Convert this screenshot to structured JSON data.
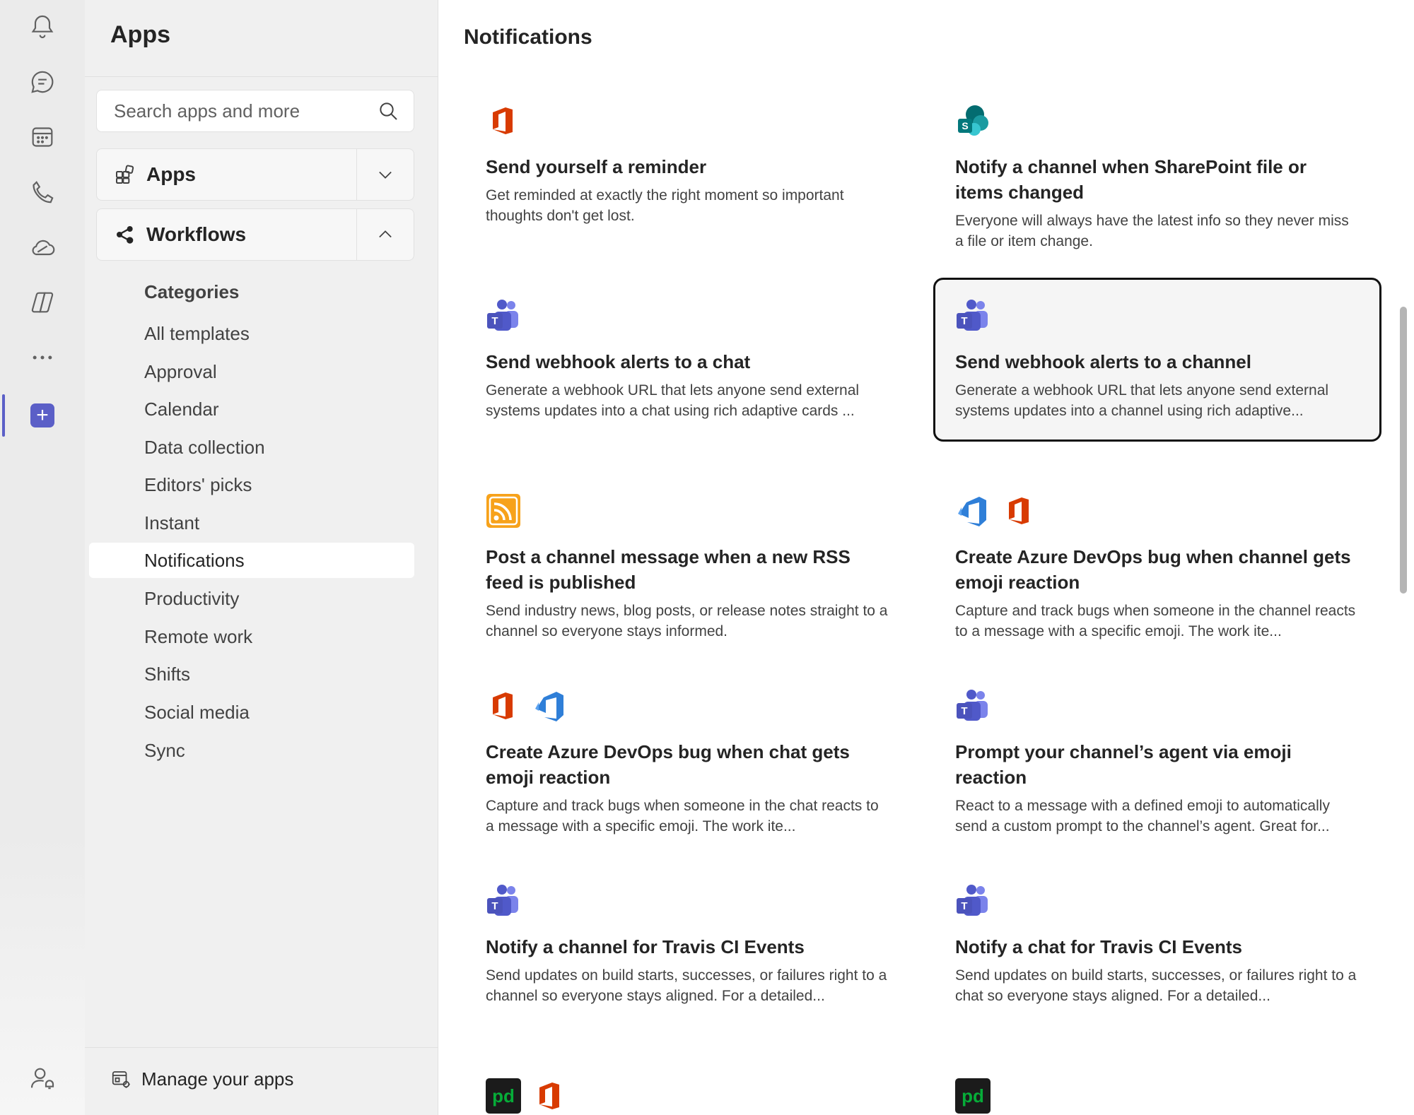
{
  "sidebar": {
    "title": "Apps",
    "search": {
      "placeholder": "Search apps and more",
      "value": ""
    },
    "sections": [
      {
        "label": "Apps",
        "expanded": false
      },
      {
        "label": "Workflows",
        "expanded": true
      }
    ],
    "categories_heading": "Categories",
    "categories": [
      "All templates",
      "Approval",
      "Calendar",
      "Data collection",
      "Editors' picks",
      "Instant",
      "Notifications",
      "Productivity",
      "Remote work",
      "Shifts",
      "Social media",
      "Sync"
    ],
    "selected_category": "Notifications",
    "manage_label": "Manage your apps"
  },
  "main": {
    "title": "Notifications",
    "cards": [
      {
        "title": "Send yourself a reminder",
        "desc": "Get reminded at exactly the right moment so important thoughts don't get lost.",
        "icons": [
          "office-icon"
        ]
      },
      {
        "title": "Notify a channel when SharePoint file or items changed",
        "desc": "Everyone will always have the latest info so they never miss a file or item change.",
        "icons": [
          "sharepoint-icon"
        ]
      },
      {
        "title": "Send webhook alerts to a chat",
        "desc": "Generate a webhook URL that lets anyone send external systems updates into a chat using rich adaptive cards ...",
        "icons": [
          "teams-icon"
        ]
      },
      {
        "title": "Send webhook alerts to a channel",
        "desc": "Generate a webhook URL that lets anyone send external systems updates into a channel using rich adaptive...",
        "icons": [
          "teams-icon"
        ]
      },
      {
        "title": "Post a channel message when a new RSS feed is published",
        "desc": "Send industry news, blog posts, or release notes straight to a channel so everyone stays informed.",
        "icons": [
          "rss-icon"
        ]
      },
      {
        "title": "Create Azure DevOps bug when channel gets emoji reaction",
        "desc": "Capture and track bugs when someone in the channel reacts to a message with a specific emoji. The work ite...",
        "icons": [
          "azure-devops-icon",
          "office-icon"
        ]
      },
      {
        "title": "Create Azure DevOps bug when chat gets emoji reaction",
        "desc": "Capture and track bugs when someone in the chat reacts to a message with a specific emoji. The work ite...",
        "icons": [
          "office-icon",
          "azure-devops-icon"
        ]
      },
      {
        "title": "Prompt your channel’s agent via emoji reaction",
        "desc": "React to a message with a defined emoji to automatically send a custom prompt to the channel’s agent. Great for...",
        "icons": [
          "teams-icon"
        ]
      },
      {
        "title": "Notify a channel for Travis CI Events",
        "desc": "Send updates on build starts, successes, or failures right to a channel so everyone stays aligned. For a detailed...",
        "icons": [
          "teams-icon"
        ]
      },
      {
        "title": "Notify a chat for Travis CI Events",
        "desc": "Send updates on build starts, successes, or failures right to a chat so everyone stays aligned. For a detailed...",
        "icons": [
          "teams-icon"
        ]
      },
      {
        "title": "",
        "desc": "",
        "icons": [
          "pagerduty-icon",
          "office-icon"
        ]
      },
      {
        "title": "",
        "desc": "",
        "icons": [
          "pagerduty-icon"
        ]
      }
    ],
    "focused_card": "Send webhook alerts to a channel",
    "pagerduty_text": "pd"
  },
  "rail": {
    "items": [
      "bell-icon",
      "chat-icon",
      "calendar-icon",
      "calls-icon",
      "onedrive-icon",
      "copilot-icon",
      "more-icon",
      "apps-icon",
      "account-icon"
    ],
    "active": "apps-icon"
  },
  "colors": {
    "accent": "#5b5fc7",
    "rail_bg": "#ebebeb",
    "sidebar_bg": "#f0f0f0",
    "office_red": "#d83b01",
    "rss_orange": "#f7a21b",
    "devops_blue": "#2f7fd8",
    "pagerduty_green": "#06ac38"
  }
}
